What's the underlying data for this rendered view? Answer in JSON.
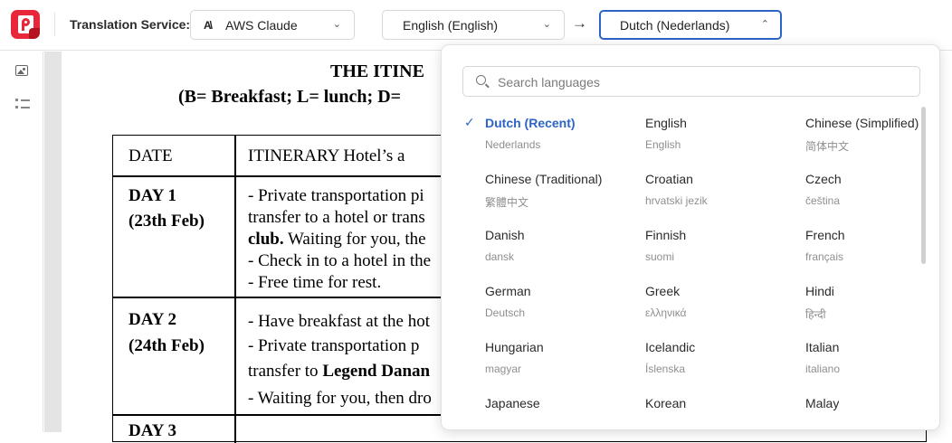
{
  "toolbar": {
    "service_label": "Translation Service:",
    "service_value": "AWS Claude",
    "service_icon": "A\\",
    "source_language": "English (English)",
    "target_language": "Dutch (Nederlands)"
  },
  "document": {
    "title": "THE ITINE",
    "subtitle": "(B= Breakfast; L= lunch; D=",
    "header_date": "DATE",
    "header_itinerary": "ITINERARY Hotel’s a",
    "day1_title": "DAY 1",
    "day1_date": "(23th Feb)",
    "day1_lines": [
      "- Private transportation pi",
      "transfer to a hotel or trans",
      "club.",
      " Waiting for you, the",
      "- Check in to a hotel in the",
      "- Free time for rest."
    ],
    "day2_title": "DAY 2",
    "day2_date": "(24th Feb)",
    "day2_lines": [
      "- Have breakfast at the hot",
      "-  Private transportation p",
      "transfer to ",
      "Legend Danan",
      "- Waiting for you, then dro"
    ],
    "day3_title": "DAY 3"
  },
  "dropdown": {
    "search_placeholder": "Search languages",
    "languages": [
      {
        "name": "Dutch (Recent)",
        "native": "Nederlands",
        "active": true
      },
      {
        "name": "English",
        "native": "English"
      },
      {
        "name": "Chinese (Simplified)",
        "native": "简体中文"
      },
      {
        "name": "Chinese (Traditional)",
        "native": "繁體中文"
      },
      {
        "name": "Croatian",
        "native": "hrvatski jezik"
      },
      {
        "name": "Czech",
        "native": "čeština"
      },
      {
        "name": "Danish",
        "native": "dansk"
      },
      {
        "name": "Finnish",
        "native": "suomi"
      },
      {
        "name": "French",
        "native": "français"
      },
      {
        "name": "German",
        "native": "Deutsch"
      },
      {
        "name": "Greek",
        "native": "ελληνικά"
      },
      {
        "name": "Hindi",
        "native": "हिन्दी"
      },
      {
        "name": "Hungarian",
        "native": "magyar"
      },
      {
        "name": "Icelandic",
        "native": "Íslenska"
      },
      {
        "name": "Italian",
        "native": "italiano"
      },
      {
        "name": "Japanese",
        "native": ""
      },
      {
        "name": "Korean",
        "native": ""
      },
      {
        "name": "Malay",
        "native": ""
      }
    ]
  },
  "colors": {
    "accent": "#2d64c7",
    "brand": "#e8273a"
  }
}
